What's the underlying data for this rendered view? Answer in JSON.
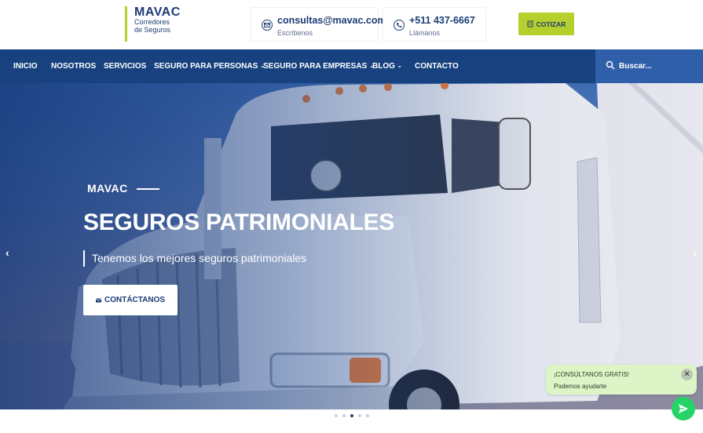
{
  "brand": {
    "name": "MAVAC",
    "tagline_line1": "Corredores",
    "tagline_line2": "de Seguros",
    "accent_color": "#b5cf2c",
    "primary_color": "#17427f"
  },
  "header": {
    "email": {
      "icon": "envelope-icon",
      "value": "consultas@mavac.com.pe",
      "label": "Escríbenos"
    },
    "phone": {
      "icon": "phone-icon",
      "value": "+511 437-6667",
      "label": "Llámanos"
    },
    "cta": {
      "icon": "quote-icon",
      "label": "COTIZAR"
    }
  },
  "nav": {
    "items": [
      {
        "label": "INICIO"
      },
      {
        "label": "NOSOTROS"
      },
      {
        "label": "SERVICIOS"
      },
      {
        "label": "SEGURO PARA PERSONAS",
        "dropdown": true
      },
      {
        "label": "SEGURO PARA EMPRESAS",
        "dropdown": true
      },
      {
        "label": "BLOG",
        "dropdown": true
      },
      {
        "label": "CONTACTO"
      }
    ],
    "search": {
      "placeholder": "Buscar..."
    }
  },
  "hero": {
    "kicker": "MAVAC",
    "title": "SEGUROS PATRIMONIALES",
    "subtitle": "Tenemos los mejores seguros patrimoniales",
    "button": {
      "icon": "envelope-icon",
      "label": "CONTÁCTANOS"
    },
    "prev_arrow": "‹",
    "next_arrow": "›",
    "slides_total": 5,
    "active_slide": 3
  },
  "chat": {
    "title": "¡CONSÚLTANOS GRATIS!",
    "subtitle": "Podemos ayudarte",
    "close": "✕"
  }
}
